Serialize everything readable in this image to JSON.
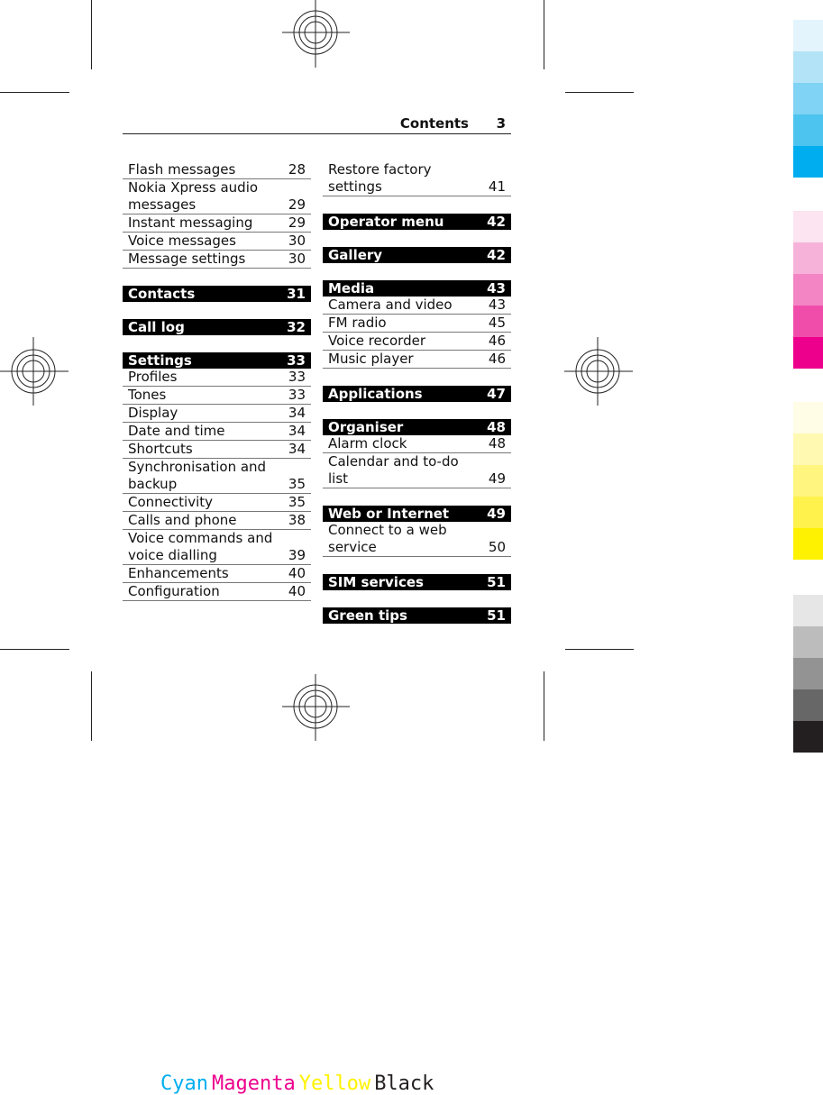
{
  "header": {
    "title": "Contents",
    "page_number": "3"
  },
  "left_column": [
    {
      "type": "entry",
      "label": "Flash messages",
      "page": "28",
      "lines": 1
    },
    {
      "type": "entry",
      "label": "Nokia Xpress audio messages",
      "page": "29",
      "lines": 2
    },
    {
      "type": "entry",
      "label": "Instant messaging",
      "page": "29",
      "lines": 1
    },
    {
      "type": "entry",
      "label": "Voice messages",
      "page": "30",
      "lines": 1
    },
    {
      "type": "entry",
      "label": "Message settings",
      "page": "30",
      "lines": 1
    },
    {
      "type": "gap"
    },
    {
      "type": "section",
      "label": "Contacts",
      "page": "31"
    },
    {
      "type": "gap"
    },
    {
      "type": "section",
      "label": "Call log",
      "page": "32"
    },
    {
      "type": "gap"
    },
    {
      "type": "section",
      "label": "Settings",
      "page": "33"
    },
    {
      "type": "entry",
      "label": "Profiles",
      "page": "33",
      "lines": 1
    },
    {
      "type": "entry",
      "label": "Tones",
      "page": "33",
      "lines": 1
    },
    {
      "type": "entry",
      "label": "Display",
      "page": "34",
      "lines": 1
    },
    {
      "type": "entry",
      "label": "Date and time",
      "page": "34",
      "lines": 1
    },
    {
      "type": "entry",
      "label": "Shortcuts",
      "page": "34",
      "lines": 1
    },
    {
      "type": "entry",
      "label": "Synchronisation and backup",
      "page": "35",
      "lines": 2
    },
    {
      "type": "entry",
      "label": "Connectivity",
      "page": "35",
      "lines": 1
    },
    {
      "type": "entry",
      "label": "Calls and phone",
      "page": "38",
      "lines": 1
    },
    {
      "type": "entry",
      "label": "Voice commands and voice dialling",
      "page": "39",
      "lines": 2
    },
    {
      "type": "entry",
      "label": "Enhancements",
      "page": "40",
      "lines": 1
    },
    {
      "type": "entry",
      "label": "Configuration",
      "page": "40",
      "lines": 1
    }
  ],
  "right_column": [
    {
      "type": "entry",
      "label": "Restore factory settings",
      "page": "41",
      "lines": 2
    },
    {
      "type": "gap"
    },
    {
      "type": "section",
      "label": "Operator menu",
      "page": "42"
    },
    {
      "type": "gap"
    },
    {
      "type": "section",
      "label": "Gallery",
      "page": "42"
    },
    {
      "type": "gap"
    },
    {
      "type": "section",
      "label": "Media",
      "page": "43"
    },
    {
      "type": "entry",
      "label": "Camera and video",
      "page": "43",
      "lines": 1
    },
    {
      "type": "entry",
      "label": "FM radio",
      "page": "45",
      "lines": 1
    },
    {
      "type": "entry",
      "label": "Voice recorder",
      "page": "46",
      "lines": 1
    },
    {
      "type": "entry",
      "label": "Music player",
      "page": "46",
      "lines": 1
    },
    {
      "type": "gap"
    },
    {
      "type": "section",
      "label": "Applications",
      "page": "47"
    },
    {
      "type": "gap"
    },
    {
      "type": "section",
      "label": "Organiser",
      "page": "48"
    },
    {
      "type": "entry",
      "label": "Alarm clock",
      "page": "48",
      "lines": 1
    },
    {
      "type": "entry",
      "label": "Calendar and to-do list",
      "page": "49",
      "lines": 2
    },
    {
      "type": "gap"
    },
    {
      "type": "section",
      "label": "Web or Internet",
      "page": "49"
    },
    {
      "type": "entry",
      "label": "Connect to a web service",
      "page": "50",
      "lines": 2
    },
    {
      "type": "gap"
    },
    {
      "type": "section",
      "label": "SIM services",
      "page": "51"
    },
    {
      "type": "gap"
    },
    {
      "type": "section",
      "label": "Green tips",
      "page": "51"
    }
  ],
  "color_bars": {
    "cyan": [
      "#e3f4fc",
      "#b3e3f7",
      "#80d3f4",
      "#4cc4ef",
      "#00aeef"
    ],
    "magenta": [
      "#fce4f0",
      "#f7b2da",
      "#f385c4",
      "#f04dab",
      "#ec008c"
    ],
    "yellow": [
      "#fffde6",
      "#fff9b2",
      "#fff57f",
      "#fff24c",
      "#fff200"
    ],
    "black": [
      "#e6e6e6",
      "#bcbcbc",
      "#939393",
      "#676767",
      "#231f20"
    ]
  },
  "cmyk_label": [
    {
      "text": "Cyan",
      "color": "#00aeef"
    },
    {
      "text": "Magenta",
      "color": "#ec008c"
    },
    {
      "text": "Yellow",
      "color": "#fff200"
    },
    {
      "text": "Black",
      "color": "#231f20"
    }
  ]
}
